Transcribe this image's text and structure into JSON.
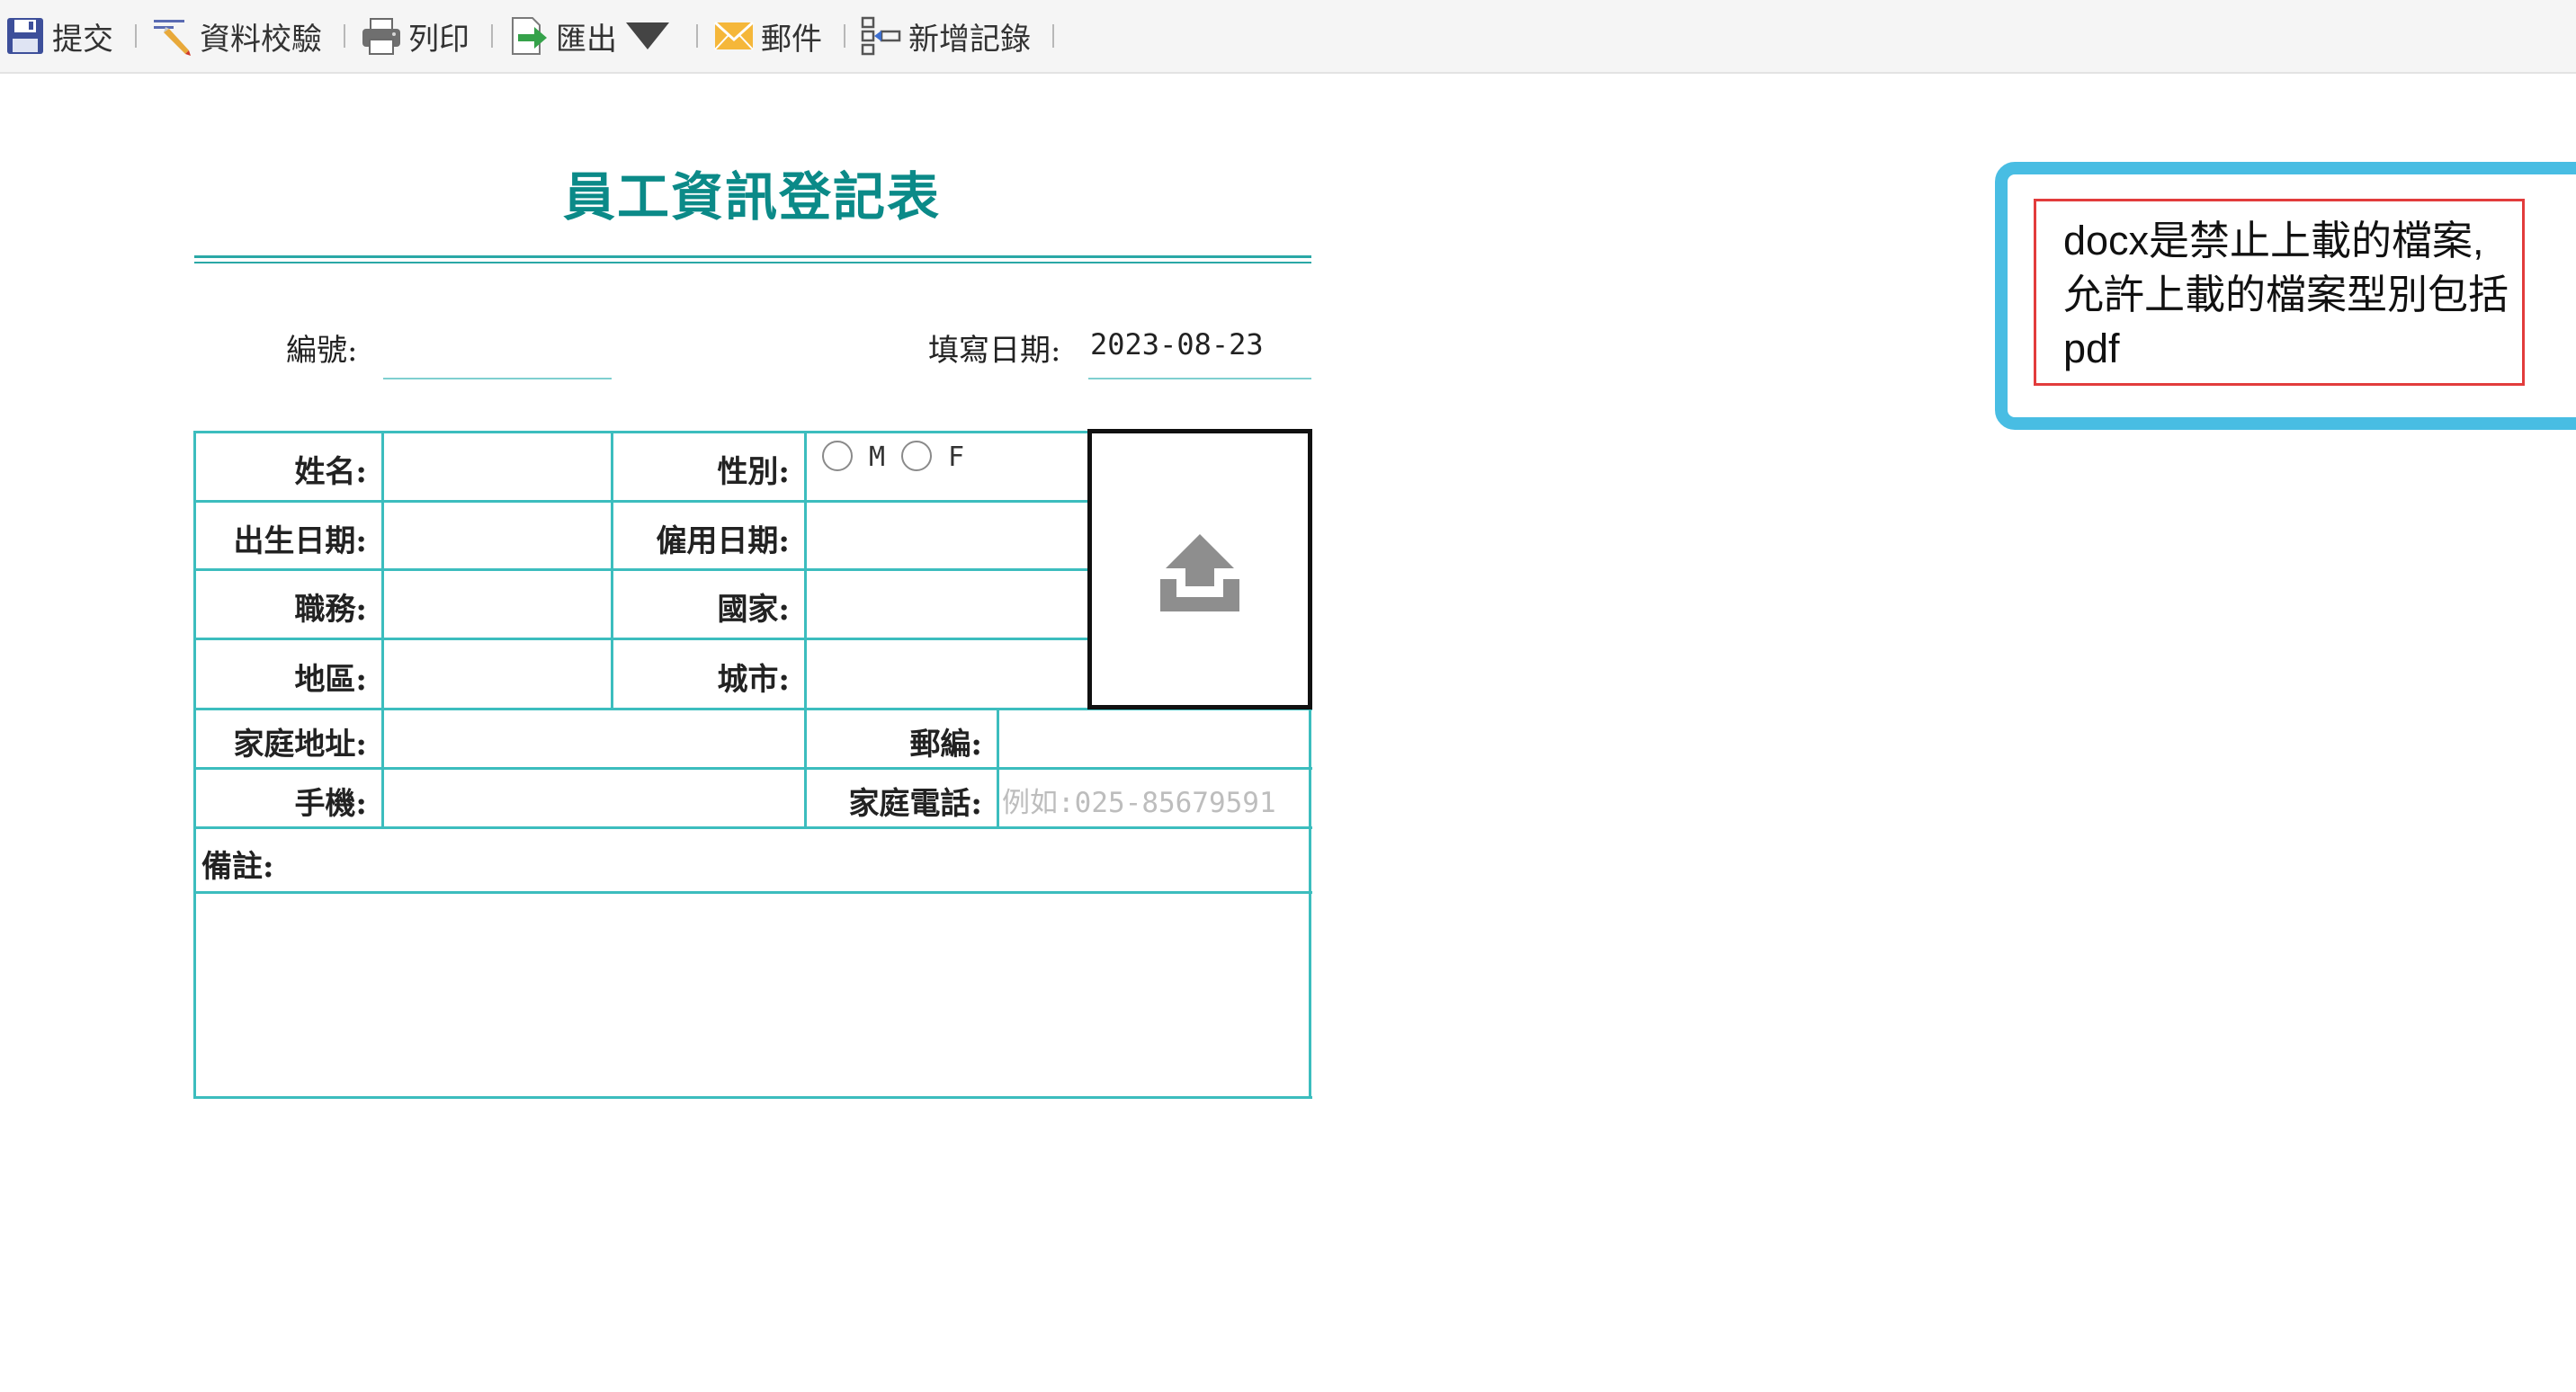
{
  "toolbar": {
    "items": [
      {
        "label": "提交",
        "icon": "save-icon"
      },
      {
        "label": "資料校驗",
        "icon": "validate-icon"
      },
      {
        "label": "列印",
        "icon": "print-icon"
      },
      {
        "label": "匯出",
        "icon": "export-icon"
      },
      {
        "label": "郵件",
        "icon": "mail-icon"
      },
      {
        "label": "新增記錄",
        "icon": "add-record-icon"
      }
    ]
  },
  "form": {
    "title": "員工資訊登記表",
    "id_label": "編號:",
    "id_value": "",
    "date_label": "填寫日期:",
    "date_value": "2023-08-23",
    "fields": {
      "name": "姓名:",
      "gender": "性別:",
      "gender_options": [
        "M",
        "F"
      ],
      "birth_date": "出生日期:",
      "hire_date": "僱用日期:",
      "title": "職務:",
      "country": "國家:",
      "region": "地區:",
      "city": "城市:",
      "address": "家庭地址:",
      "zip": "郵編:",
      "mobile": "手機:",
      "home_phone": "家庭電話:",
      "home_phone_placeholder": "例如:025-85679591",
      "notes": "備註:"
    }
  },
  "callout": {
    "message": "docx是禁止上載的檔案,允許上載的檔案型別包括pdf"
  },
  "colors": {
    "title": "#0b8a88",
    "grid": "#3cbdbe",
    "callout_border": "#48bde3",
    "callout_inner_border": "#e23c3c"
  }
}
